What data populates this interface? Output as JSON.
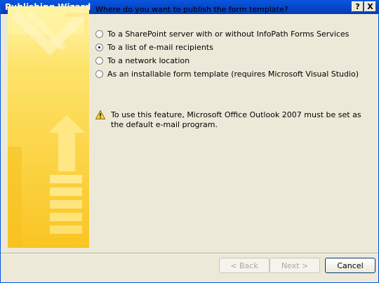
{
  "window": {
    "title": "Publishing Wizard",
    "help_glyph": "?",
    "close_glyph": "X"
  },
  "question": "Where do you want to publish the form template?",
  "options": [
    {
      "label": "To a SharePoint server with or without InfoPath Forms Services",
      "checked": false
    },
    {
      "label": "To a list of e-mail recipients",
      "checked": true
    },
    {
      "label": "To a network location",
      "checked": false
    },
    {
      "label": "As an installable form template (requires Microsoft Visual Studio)",
      "checked": false
    }
  ],
  "warning": {
    "icon": "warning-icon",
    "line1": "To use this feature, Microsoft Office Outlook 2007 must be set as",
    "line2": "the default e-mail program."
  },
  "buttons": {
    "back": "< Back",
    "next": "Next >",
    "cancel": "Cancel"
  },
  "colors": {
    "accent_yellow": "#fcd233",
    "titlebar_blue": "#0a56de",
    "dialog_bg": "#ece9d8"
  }
}
